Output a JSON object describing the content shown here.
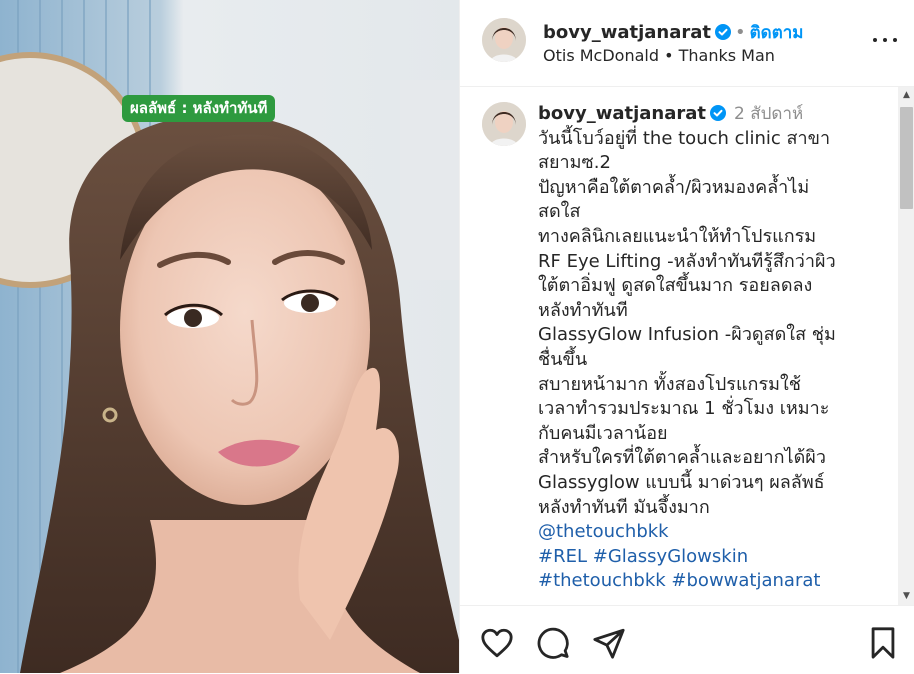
{
  "media": {
    "overlay_text": "ผลลัพธ์ : หลังทำทันที"
  },
  "header": {
    "username": "bovy_watjanarat",
    "separator": "•",
    "follow_label": "ติดตาม",
    "audio": "Otis McDonald • Thanks Man"
  },
  "caption": {
    "username": "bovy_watjanarat",
    "time": "2 สัปดาห์",
    "first_line": "วันนี้โบว์อยู่ที่ the touch clinic สาขา",
    "lines": [
      "สยามซ.2",
      "ปัญหาคือใต้ตาคล้ำ/ผิวหมองคล้ำไม่",
      "สดใส",
      "ทางคลินิกเลยแนะนำให้ทำโปรแกรม",
      "RF Eye Lifting -หลังทำทันทีรู้สึกว่าผิว",
      "ใต้ตาอิ่มฟู ดูสดใสขึ้นมาก รอยลดลง",
      "หลังทำทันที",
      "GlassyGlow Infusion -ผิวดูสดใส ชุ่ม",
      "ชื่นขึ้น",
      "สบายหน้ามาก ทั้งสองโปรแกรมใช้",
      "เวลาทำรวมประมาณ 1 ชั่วโมง เหมาะ",
      "กับคนมีเวลาน้อย",
      "สำหรับใครที่ใต้ตาคล้ำและอยากได้ผิว",
      "Glassyglow แบบนี้ มาด่วนๆ ผลลัพธ์",
      "หลังทำทันที มันจึ้งมาก"
    ],
    "mention": "@thetouchbkk",
    "hashtags_line1": [
      "#REL",
      "#GlassyGlowskin"
    ],
    "hashtags_line2": [
      "#thetouchbkk",
      "#bowwatjanarat"
    ]
  },
  "icons": {
    "like": "heart-icon",
    "comment": "comment-icon",
    "share": "share-icon",
    "save": "bookmark-icon",
    "more": "more-options-icon",
    "verified": "verified-badge-icon"
  },
  "colors": {
    "follow": "#0095f6",
    "verified": "#0095f6",
    "hashtag": "#1f5faa",
    "overlay_bg": "#2e9a3f"
  }
}
